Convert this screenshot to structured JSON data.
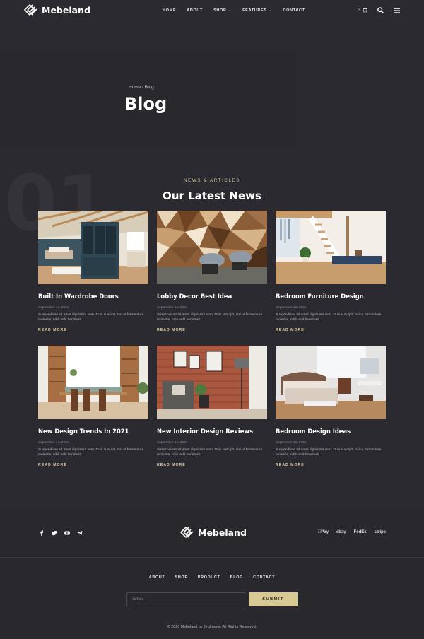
{
  "header": {
    "brand": "Mebeland",
    "nav": [
      {
        "label": "HOME",
        "dropdown": false
      },
      {
        "label": "ABOUT",
        "dropdown": false
      },
      {
        "label": "SHOP",
        "dropdown": true
      },
      {
        "label": "FEATURES",
        "dropdown": true
      },
      {
        "label": "CONTACT",
        "dropdown": false
      }
    ],
    "cart_count": "3",
    "icons": [
      "cart-icon",
      "search-icon",
      "menu-icon"
    ]
  },
  "page_header": {
    "breadcrumb": "Home / Blog",
    "title": "Blog"
  },
  "news": {
    "number": "01",
    "kicker": "NEWS & ARTICLES",
    "title": "Our Latest News",
    "read_more": "READ MORE",
    "posts": [
      {
        "title": "Built In Wardrobe Doors",
        "date": "September 14, 2021",
        "excerpt": "Suspendisse sit amet dignissim sem. Duis suscipit, nisi ut fermentum molestie, nibh velit hendrerit."
      },
      {
        "title": "Lobby Decor Best Idea",
        "date": "September 14, 2021",
        "excerpt": "Suspendisse sit amet dignissim sem. Duis suscipit, nisi ut fermentum molestie, nibh velit hendrerit."
      },
      {
        "title": "Bedroom Furniture Design",
        "date": "September 14, 2021",
        "excerpt": "Suspendisse sit amet dignissim sem. Duis suscipit, nisi ut fermentum molestie, nibh velit hendrerit."
      },
      {
        "title": "New Design Trends In 2021",
        "date": "September 14, 2021",
        "excerpt": "Suspendisse sit amet dignissim sem. Duis suscipit, nisi ut fermentum molestie, nibh velit hendrerit."
      },
      {
        "title": "New Interior Design Reviews",
        "date": "September 14, 2021",
        "excerpt": "Suspendisse sit amet dignissim sem. Duis suscipit, nisi ut fermentum molestie, nibh velit hendrerit."
      },
      {
        "title": "Bedroom Design Ideas",
        "date": "September 14, 2021",
        "excerpt": "Suspendisse sit amet dignissim sem. Duis suscipit, nisi ut fermentum molestie, nibh velit hendrerit."
      }
    ]
  },
  "footer": {
    "brand": "Mebeland",
    "socials": [
      "facebook-icon",
      "twitter-icon",
      "youtube-icon",
      "telegram-icon"
    ],
    "payments": [
      "Pay",
      "ebay",
      "FedEx",
      "stripe"
    ],
    "nav": [
      "ABOUT",
      "SHOP",
      "PRODUCT",
      "BLOG",
      "CONTACT"
    ],
    "email_placeholder": "Email",
    "submit_label": "SUBMIT",
    "copyright": "© 2020 Mebeland by Jegtheme. All Rights Reserved."
  },
  "colors": {
    "background": "#2b2a30",
    "accent": "#d9c995",
    "kicker": "#d9c89a"
  }
}
